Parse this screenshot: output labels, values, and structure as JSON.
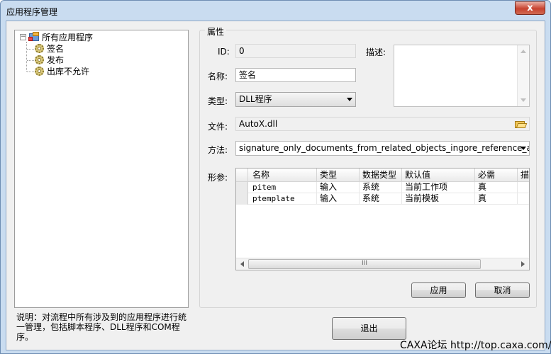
{
  "window": {
    "title": "应用程序管理",
    "close_glyph": "x"
  },
  "tree": {
    "root_label": "所有应用程序",
    "root_expander": "−",
    "items": [
      {
        "label": "签名"
      },
      {
        "label": "发布"
      },
      {
        "label": "出库不允许"
      }
    ]
  },
  "note": "说明：对流程中所有涉及到的应用程序进行统一管理，包括脚本程序、DLL程序和COM程序。",
  "properties": {
    "group_title": "属性",
    "id_label": "ID:",
    "id_value": "0",
    "desc_label": "描述:",
    "desc_value": "",
    "name_label": "名称:",
    "name_value": "签名",
    "type_label": "类型:",
    "type_value": "DLL程序",
    "file_label": "文件:",
    "file_value": "AutoX.dll",
    "method_label": "方法:",
    "method_value": "signature_only_documents_from_related_objects_ingore_reference_and_release",
    "params_label": "形参:"
  },
  "params_table": {
    "columns": [
      "名称",
      "类型",
      "数据类型",
      "默认值",
      "必需",
      "描"
    ],
    "rows": [
      [
        "pitem",
        "输入",
        "系统",
        "当前工作项",
        "真"
      ],
      [
        "ptemplate",
        "输入",
        "系统",
        "当前模板",
        "真"
      ]
    ],
    "scroll_thumb_grip": "III"
  },
  "buttons": {
    "apply": "应用",
    "cancel": "取消",
    "exit": "退出"
  },
  "watermark": "CAXA论坛 http://top.caxa.com/",
  "colors": {
    "window_frame": "#c9dcf0",
    "client_bg": "#f0f0f0",
    "close_button": "#c7422e"
  }
}
